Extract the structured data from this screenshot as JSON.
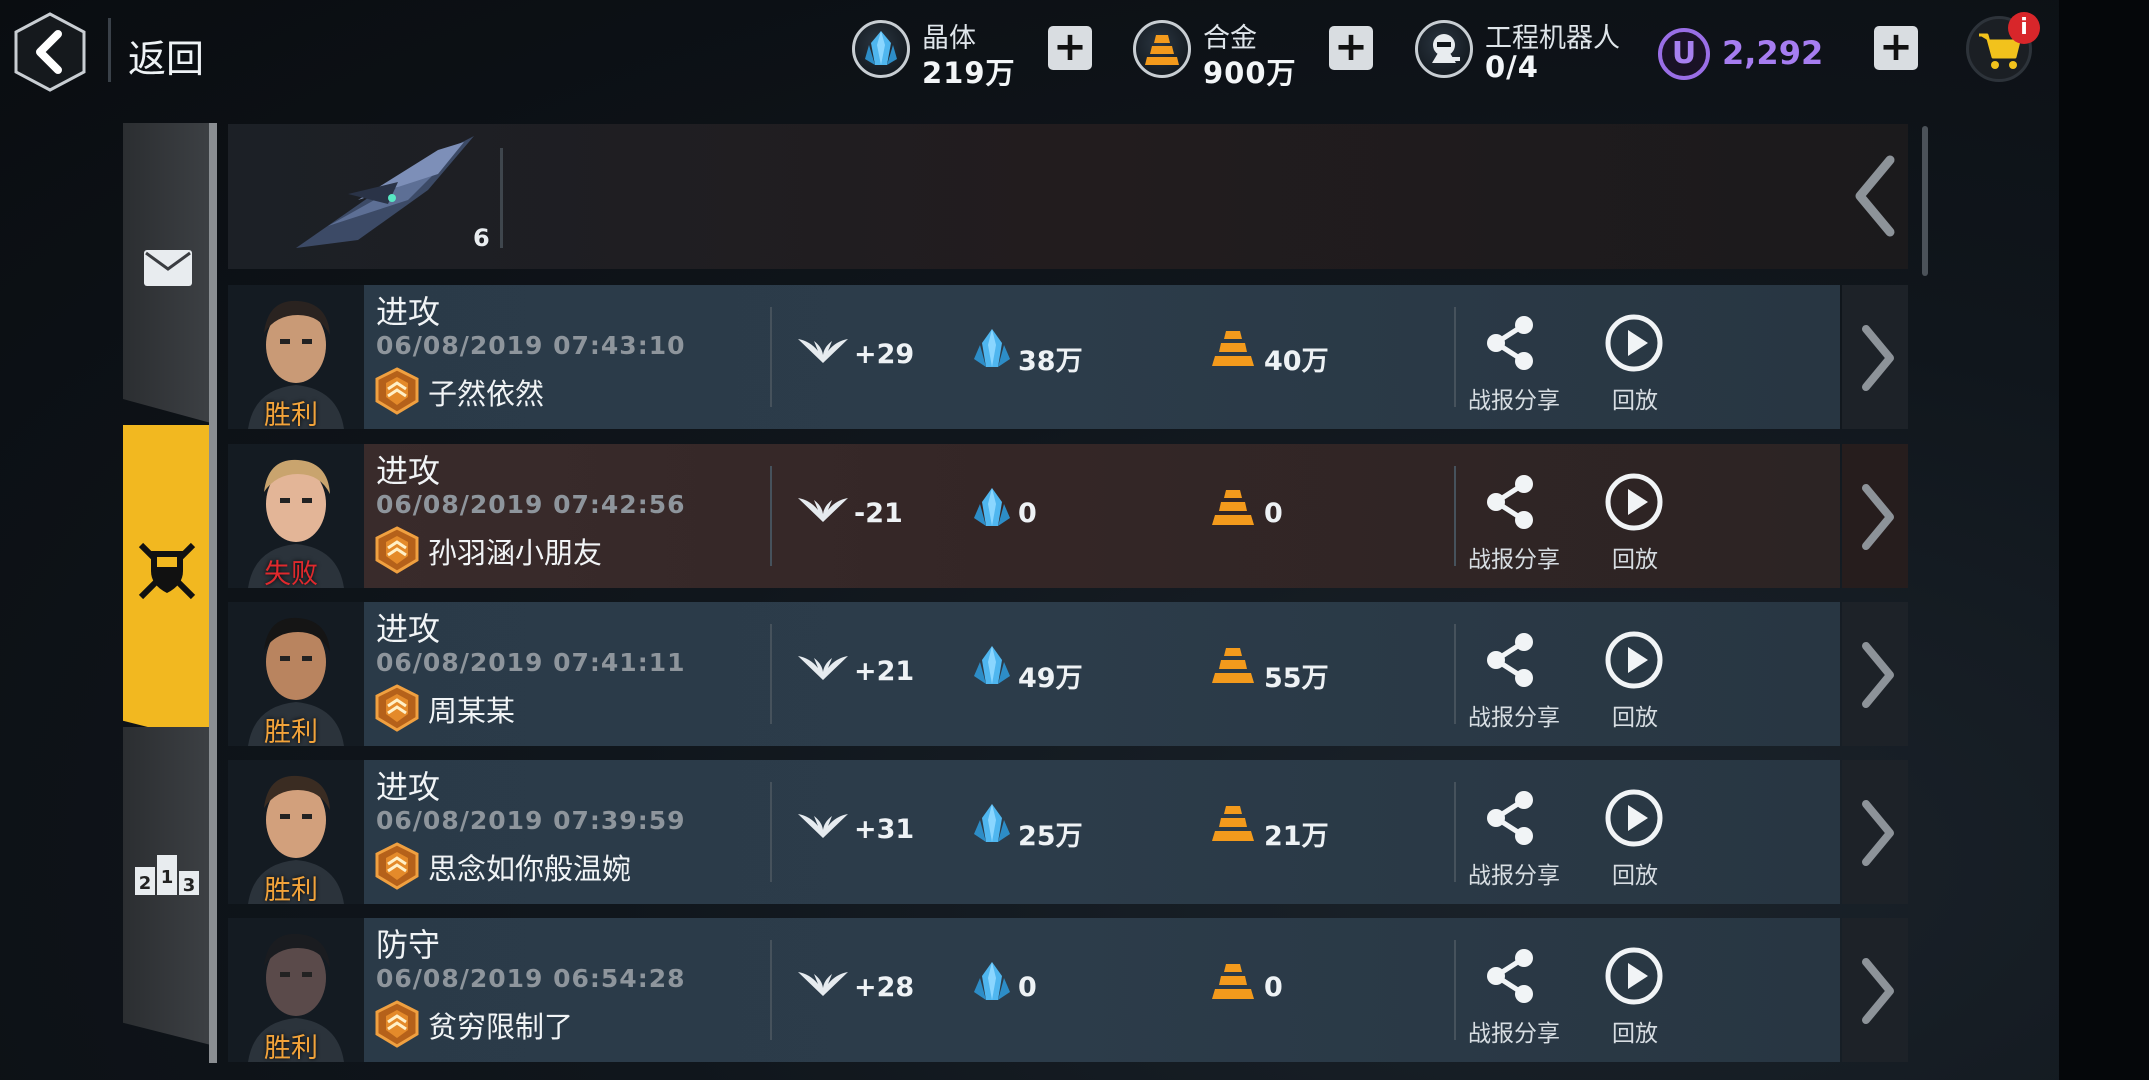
{
  "topbar": {
    "back_label": "返回",
    "crystal": {
      "label": "晶体",
      "value": "219万"
    },
    "alloy": {
      "label": "合金",
      "value": "900万"
    },
    "robot": {
      "label": "工程机器人",
      "value": "0/4"
    },
    "u_letter": "U",
    "u_value": "2,292",
    "plus": "+",
    "cart_badge": "i"
  },
  "header": {
    "ship_count": "6"
  },
  "side_tabs": {
    "rank_digits": [
      "2",
      "1",
      "3"
    ]
  },
  "colors": {
    "accent_yellow": "#f2b820",
    "win_orange": "#f2a33a",
    "lose_red": "#e0292d",
    "premium_purple": "#a67df0",
    "crystal_blue": "#4fb6ef",
    "alloy_orange": "#f39a1c"
  },
  "row_labels": {
    "share": "战报分享",
    "replay": "回放"
  },
  "rows": [
    {
      "type": "进攻",
      "time": "06/08/2019 07:43:10",
      "player": "子然依然",
      "result": "胜利",
      "medal": "+29",
      "crystal": "38万",
      "alloy": "40万"
    },
    {
      "type": "进攻",
      "time": "06/08/2019 07:42:56",
      "player": "孙羽涵小朋友",
      "result": "失败",
      "medal": "-21",
      "crystal": "0",
      "alloy": "0"
    },
    {
      "type": "进攻",
      "time": "06/08/2019 07:41:11",
      "player": "周某某",
      "result": "胜利",
      "medal": "+21",
      "crystal": "49万",
      "alloy": "55万"
    },
    {
      "type": "进攻",
      "time": "06/08/2019 07:39:59",
      "player": "思念如你般温婉",
      "result": "胜利",
      "medal": "+31",
      "crystal": "25万",
      "alloy": "21万"
    },
    {
      "type": "防守",
      "time": "06/08/2019 06:54:28",
      "player": "贫穷限制了",
      "result": "胜利",
      "medal": "+28",
      "crystal": "0",
      "alloy": "0"
    }
  ]
}
